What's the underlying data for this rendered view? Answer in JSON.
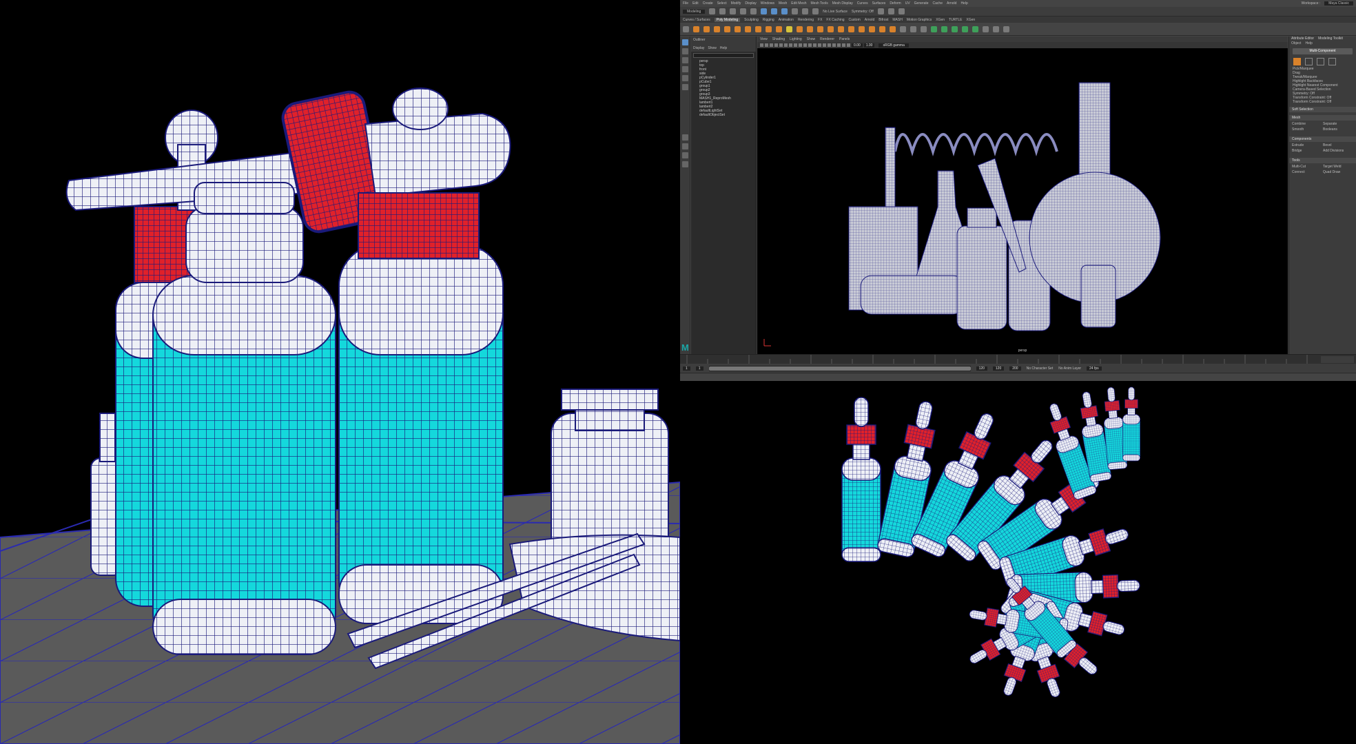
{
  "maya": {
    "menubar": [
      "File",
      "Edit",
      "Create",
      "Select",
      "Modify",
      "Display",
      "Windows",
      "Mesh",
      "Edit Mesh",
      "Mesh Tools",
      "Mesh Display",
      "Curves",
      "Surfaces",
      "Deform",
      "UV",
      "Generate",
      "Cache",
      "Arnold",
      "Help"
    ],
    "workspace_label": "Workspace :",
    "workspace_value": "Maya Classic",
    "menuset": "Modeling",
    "live_surface": "No Live Surface",
    "symmetry": "Symmetry: Off",
    "shelf_tabs": [
      "Curves / Surfaces",
      "Poly Modeling",
      "Sculpting",
      "Rigging",
      "Animation",
      "Rendering",
      "FX",
      "FX Caching",
      "Custom",
      "Arnold",
      "Bifrost",
      "MASH",
      "Motion Graphics",
      "XGen",
      "TURTLE",
      "XGen"
    ],
    "shelf_active_tab": "Poly Modeling",
    "outliner": {
      "title": "Outliner",
      "menus": [
        "Display",
        "Show",
        "Help"
      ],
      "items": [
        "persp",
        "top",
        "front",
        "side",
        "pCylinder1",
        "pCube1",
        "group1",
        "group2",
        "group3",
        "MASH1_ReproMesh",
        "lambert1",
        "lambert2",
        "defaultLightSet",
        "defaultObjectSet"
      ]
    },
    "viewport": {
      "menus": [
        "View",
        "Shading",
        "Lighting",
        "Show",
        "Renderer",
        "Panels"
      ],
      "field_a": "0.00",
      "field_b": "1.00",
      "color_space": "sRGB gamma",
      "camera_label": "persp"
    },
    "modeling_toolkit": {
      "tabs": [
        "Attribute Editor",
        "Modeling Toolkit"
      ],
      "menus": [
        "Object",
        "Help"
      ],
      "mode_button": "Multi-Component",
      "options": [
        "Pick/Marquee",
        "Drag",
        "Tweak/Marquee",
        "Highlight Backfaces",
        "Highlight Nearest Component"
      ],
      "rows": [
        "Camera-Based Selection",
        "Symmetry: Off",
        "Transform Constraint: Off",
        "Transform Constraint: Off"
      ],
      "sections": [
        {
          "title": "Soft Selection",
          "items": []
        },
        {
          "title": "Mesh",
          "items": [
            "Combine",
            "Separate",
            "Smooth",
            "Booleans"
          ]
        },
        {
          "title": "Components",
          "items": [
            "Extrude",
            "Bevel",
            "Bridge",
            "Add Divisions"
          ]
        },
        {
          "title": "Tools",
          "items": [
            "Multi-Cut",
            "Target Weld",
            "Connect",
            "Quad Draw"
          ]
        }
      ]
    },
    "timeline": {
      "start": "1",
      "start_inner": "1",
      "end_inner": "120",
      "end": "120",
      "end2": "200",
      "character_set": "No Character Set",
      "anim_layer": "No Anim Layer",
      "fps": "24 fps"
    }
  },
  "colors": {
    "wire": "#1a1a7a",
    "liquid": "#14d8dc",
    "cap": "#e0212a",
    "glass": "#eef0f6",
    "maya_accent": "#1ba6a6",
    "selection": "#d9822b"
  },
  "icons": [
    "select-tool-icon",
    "lasso-icon",
    "paint-icon",
    "move-icon",
    "rotate-icon",
    "scale-icon",
    "maya-logo-icon"
  ]
}
